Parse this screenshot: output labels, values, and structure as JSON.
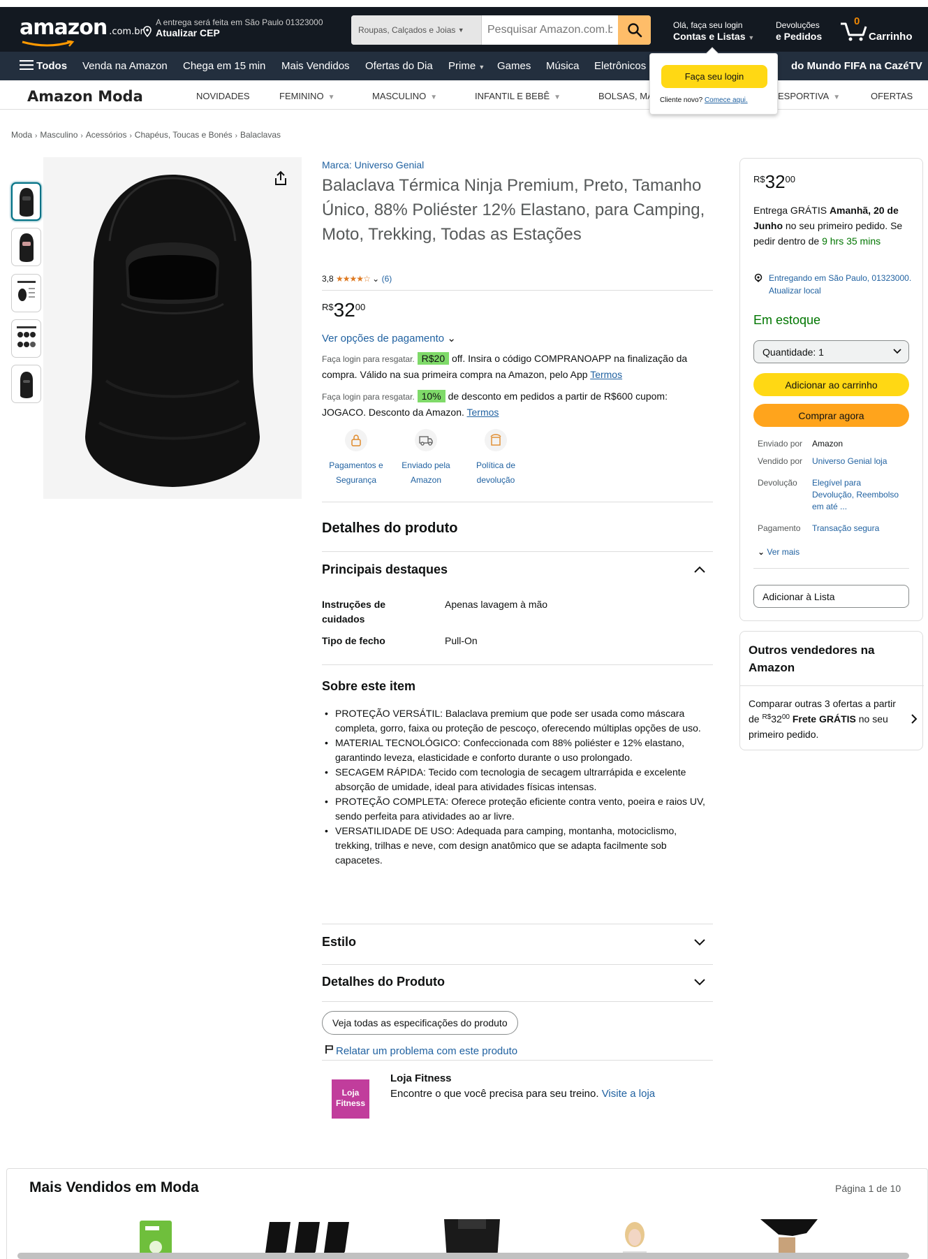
{
  "header": {
    "logo": "amazon",
    "logo_tld": ".com.br",
    "deliver_line1": "A entrega será feita em São Paulo 01323000",
    "deliver_line2": "Atualizar CEP",
    "search_category": "Roupas, Calçados e Joias",
    "search_placeholder": "Pesquisar Amazon.com.br",
    "account_line1": "Olá, faça seu login",
    "account_line2": "Contas e Listas",
    "returns_line1": "Devoluções",
    "returns_line2": "e Pedidos",
    "cart_count": "0",
    "cart_label": "Carrinho"
  },
  "nav": {
    "all": "Todos",
    "items": [
      "Venda na Amazon",
      "Chega em 15 min",
      "Mais Vendidos",
      "Ofertas do Dia",
      "Prime",
      "Games",
      "Música",
      "Eletrônicos"
    ],
    "right": "do Mundo FIFA na CazéTV"
  },
  "login_flyout": {
    "button": "Faça seu login",
    "new_customer": "Cliente novo?",
    "start_here": "Comece aqui."
  },
  "subnav": {
    "brand": "Amazon Moda",
    "categories": [
      "NOVIDADES",
      "FEMININO",
      "MASCULINO",
      "INFANTIL E BEBÊ",
      "BOLSAS, MA",
      "ESPORTIVA",
      "OFERTAS"
    ]
  },
  "breadcrumb": [
    "Moda",
    "Masculino",
    "Acessórios",
    "Chapéus, Toucas e Bonés",
    "Balaclavas"
  ],
  "product": {
    "brand": "Marca: Universo Genial",
    "title": "Balaclava Térmica Ninja Premium, Preto, Tamanho Único, 88% Poliéster 12% Elastano, para Camping, Moto, Trekking, Todas as Estações",
    "rating_value": "3,8",
    "rating_stars": "★★★★☆",
    "rating_count": "(6)",
    "price_currency": "R$",
    "price_whole": "32",
    "price_fraction": "00",
    "payment_options": "Ver opções de pagamento",
    "promo1_prefix": "Faça login para resgatar.",
    "promo1_badge": "R$20",
    "promo1_text": "off. Insira o código COMPRANOAPP na finalização da compra. Válido na sua primeira compra na Amazon, pelo App",
    "promo2_prefix": "Faça login para resgatar.",
    "promo2_badge": "10%",
    "promo2_text": "de desconto em pedidos a partir de R$600 cupom: JOGACO. Desconto da Amazon.",
    "terms": "Termos",
    "features": [
      {
        "label": "Pagamentos e Segurança",
        "icon": "lock-icon"
      },
      {
        "label": "Enviado pela Amazon",
        "icon": "truck-icon"
      },
      {
        "label": "Política de devolução",
        "icon": "return-box-icon"
      }
    ]
  },
  "details": {
    "heading": "Detalhes do produto",
    "highlights_heading": "Principais destaques",
    "specs": [
      {
        "key": "Instruções de cuidados",
        "value": "Apenas lavagem à mão"
      },
      {
        "key": "Tipo de fecho",
        "value": "Pull-On"
      }
    ],
    "about_heading": "Sobre este item",
    "about": [
      "PROTEÇÃO VERSÁTIL: Balaclava premium que pode ser usada como máscara completa, gorro, faixa ou proteção de pescoço, oferecendo múltiplas opções de uso.",
      "MATERIAL TECNOLÓGICO: Confeccionada com 88% poliéster e 12% elastano, garantindo leveza, elasticidade e conforto durante o uso prolongado.",
      "SECAGEM RÁPIDA: Tecido com tecnologia de secagem ultrarrápida e excelente absorção de umidade, ideal para atividades físicas intensas.",
      "PROTEÇÃO COMPLETA: Oferece proteção eficiente contra vento, poeira e raios UV, sendo perfeita para atividades ao ar livre.",
      "VERSATILIDADE DE USO: Adequada para camping, montanha, motociclismo, trekking, trilhas e neve, com design anatômico que se adapta facilmente sob capacetes."
    ],
    "style_heading": "Estilo",
    "product_details_heading": "Detalhes do Produto",
    "all_specs_button": "Veja todas as especificações do produto",
    "report": "Relatar um problema com este produto"
  },
  "store": {
    "logo_text": "Loja Fitness",
    "name": "Loja Fitness",
    "desc": "Encontre o que você precisa para seu treino.",
    "link": "Visite a loja"
  },
  "buybox": {
    "price_currency": "R$",
    "price_whole": "32",
    "price_fraction": "00",
    "delivery_prefix": "Entrega GRÁTIS",
    "delivery_date": "Amanhã, 20 de Junho",
    "delivery_mid": "no seu primeiro pedido. Se pedir dentro de",
    "delivery_countdown": "9 hrs 35 mins",
    "location": "Entregando em São Paulo, 01323000. Atualizar local",
    "stock": "Em estoque",
    "quantity": "Quantidade: 1",
    "add_to_cart": "Adicionar ao carrinho",
    "buy_now": "Comprar agora",
    "info": [
      {
        "key": "Enviado por",
        "value": "Amazon",
        "link": false
      },
      {
        "key": "Vendido por",
        "value": "Universo Genial loja",
        "link": true
      },
      {
        "key": "Devolução",
        "value": "Elegível para Devolução, Reembolso em até ...",
        "link": true
      },
      {
        "key": "Pagamento",
        "value": "Transação segura",
        "link": true
      }
    ],
    "see_more": "Ver mais",
    "add_to_list": "Adicionar à Lista"
  },
  "other_sellers": {
    "heading": "Outros vendedores na Amazon",
    "compare_prefix": "Comparar outras 3 ofertas a partir de",
    "price_currency": "R$",
    "price_whole": "32",
    "price_fraction": "00",
    "free_shipping": "Frete GRÁTIS",
    "suffix": "no seu primeiro pedido."
  },
  "bestsellers": {
    "heading": "Mais Vendidos em Moda",
    "page": "Página 1 de 10"
  },
  "colors": {
    "header_bg": "#131921",
    "nav_bg": "#232f3e",
    "link": "#2162a1",
    "button_yellow": "#ffd814",
    "button_orange": "#ffa41c",
    "in_stock_green": "#007600",
    "promo_green": "#7fda69"
  }
}
